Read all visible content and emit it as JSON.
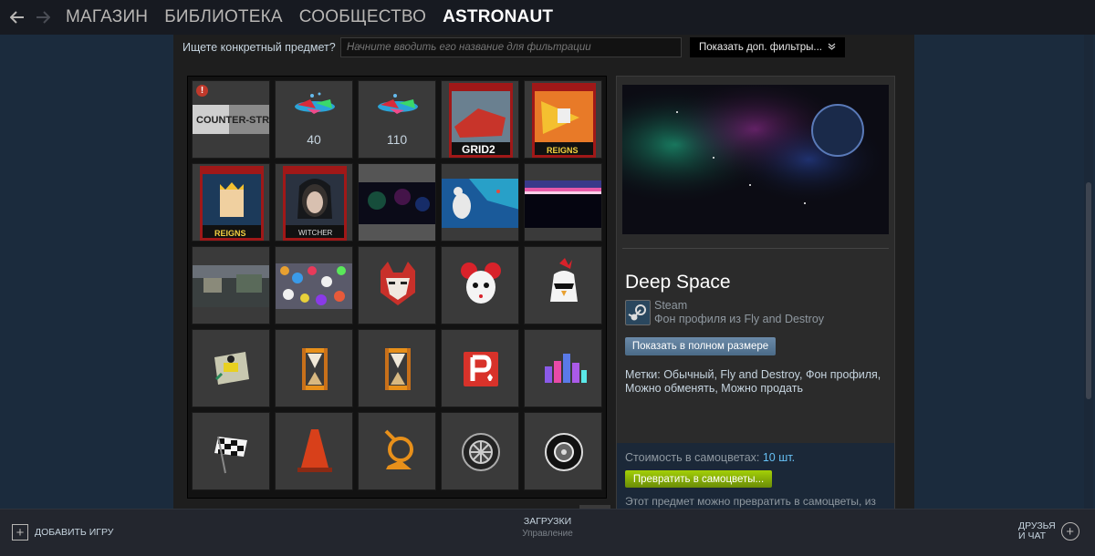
{
  "nav": {
    "back_icon": "arrow-left-icon",
    "forward_icon": "arrow-right-icon",
    "links": [
      "МАГАЗИН",
      "БИБЛИОТЕКА",
      "СООБЩЕСТВО",
      "ASTRONAUT"
    ],
    "active": "ASTRONAUT"
  },
  "filter": {
    "label": "Ищете конкретный предмет?",
    "placeholder": "Начните вводить его название для фильтрации",
    "more_filters": "Показать доп. фильтры..."
  },
  "inventory": {
    "items": [
      {
        "name": "Counter-Strike: Source background",
        "warning": true
      },
      {
        "name": "Gems",
        "count": "40"
      },
      {
        "name": "Gems",
        "count": "110"
      },
      {
        "name": "GRID 2 trading card"
      },
      {
        "name": "Reigns trading card"
      },
      {
        "name": "Reigns trading card 2"
      },
      {
        "name": "The Witcher trading card"
      },
      {
        "name": "Deep Space background"
      },
      {
        "name": "Rat background"
      },
      {
        "name": "Horizon background"
      },
      {
        "name": "Landscape background"
      },
      {
        "name": "Collage background"
      },
      {
        "name": "Fox emoticon"
      },
      {
        "name": "Mouse emoticon"
      },
      {
        "name": "Chicken emoticon"
      },
      {
        "name": "Cassette emoticon"
      },
      {
        "name": "Hourglass emoticon"
      },
      {
        "name": "Hourglass emoticon 2"
      },
      {
        "name": "P emoticon"
      },
      {
        "name": "City emoticon"
      },
      {
        "name": "Checkered flag emoticon"
      },
      {
        "name": "Traffic cone emoticon"
      },
      {
        "name": "Horn emoticon"
      },
      {
        "name": "Wheel emoticon"
      },
      {
        "name": "Tire emoticon"
      }
    ]
  },
  "detail": {
    "name": "Deep Space",
    "game": "Steam",
    "type": "Фон профиля из Fly and Destroy",
    "fullsize_button": "Показать в полном размере",
    "tags": "Метки: Обычный, Fly and Destroy, Фон профиля, Можно обменять, Можно продать",
    "gems_label": "Стоимость в самоцветах:",
    "gems_value": "10 шт.",
    "gems_button": "Превратить в самоцветы...",
    "gems_note": "Этот предмет можно превратить в самоцветы, из"
  },
  "bottom": {
    "add_game": "ДОБАВИТЬ ИГРУ",
    "downloads": "ЗАГРУЗКИ",
    "downloads_sub": "Управление",
    "friends_line1": "ДРУЗЬЯ",
    "friends_line2": "И ЧАТ"
  },
  "colors": {
    "nav_bg": "#171a21",
    "page_bg": "#1b2838",
    "gems_button": "#a4d007",
    "link_blue": "#66c0f4"
  }
}
